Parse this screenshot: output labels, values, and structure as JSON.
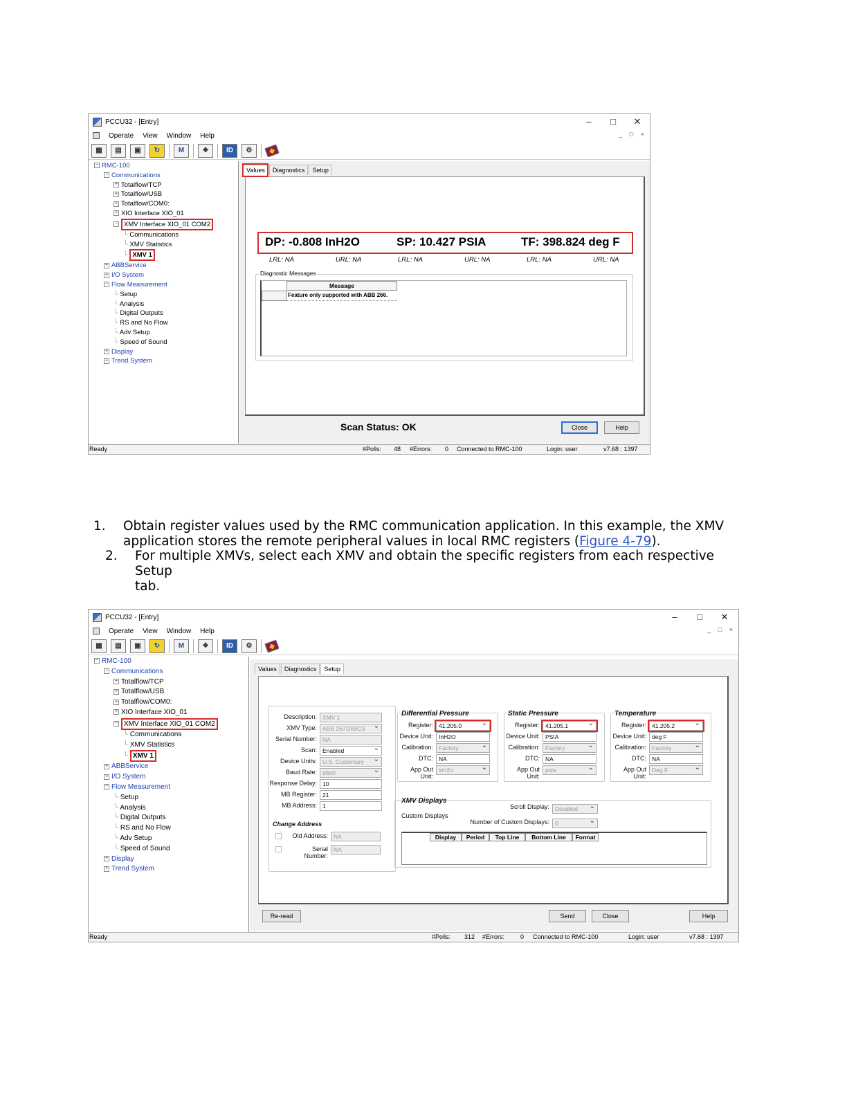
{
  "screen1": {
    "title": "PCCU32 - [Entry]",
    "menu": [
      "Operate",
      "View",
      "Window",
      "Help"
    ],
    "toolbar_icons": [
      "entry-icon",
      "collect-icon",
      "connect-icon",
      "refresh-icon",
      "station-icon",
      "network-icon",
      "calibrate-icon",
      "setup-icon",
      "help-book-icon"
    ],
    "tree": [
      {
        "label": "RMC-100",
        "level": 0,
        "toggle": "minus",
        "blue": true
      },
      {
        "label": "Communications",
        "level": 1,
        "toggle": "minus",
        "blue": true
      },
      {
        "label": "Totalflow/TCP",
        "level": 2,
        "toggle": "plus"
      },
      {
        "label": "Totalflow/USB",
        "level": 2,
        "toggle": "plus"
      },
      {
        "label": "Totalflow/COM0:",
        "level": 2,
        "toggle": "plus"
      },
      {
        "label": "XIO Interface XIO_01",
        "level": 2,
        "toggle": "plus"
      },
      {
        "label": "XMV Interface XIO_01 COM2",
        "level": 2,
        "toggle": "minus",
        "boxed": true
      },
      {
        "label": "Communications",
        "level": 3
      },
      {
        "label": "XMV Statistics",
        "level": 3
      },
      {
        "label": "XMV 1",
        "level": 3,
        "boxed": true,
        "bold": true
      },
      {
        "label": "ABBService",
        "level": 1,
        "toggle": "plus",
        "blue": true
      },
      {
        "label": "I/O System",
        "level": 1,
        "toggle": "plus",
        "blue": true
      },
      {
        "label": "Flow Measurement",
        "level": 1,
        "toggle": "minus",
        "blue": true
      },
      {
        "label": "Setup",
        "level": 2
      },
      {
        "label": "Analysis",
        "level": 2
      },
      {
        "label": "Digital Outputs",
        "level": 2
      },
      {
        "label": "RS and No Flow",
        "level": 2
      },
      {
        "label": "Adv Setup",
        "level": 2
      },
      {
        "label": "Speed of Sound",
        "level": 2
      },
      {
        "label": "Display",
        "level": 1,
        "toggle": "plus",
        "blue": true
      },
      {
        "label": "Trend System",
        "level": 1,
        "toggle": "plus",
        "blue": true
      }
    ],
    "tabs": [
      "Values",
      "Diagnostics",
      "Setup"
    ],
    "readings": {
      "dp": "DP: -0.808 InH2O",
      "sp": "SP: 10.427 PSIA",
      "tf": "TF: 398.824 deg F"
    },
    "limits": [
      "LRL: NA",
      "URL: NA",
      "LRL: NA",
      "URL: NA",
      "LRL: NA",
      "URL: NA"
    ],
    "diag_group": "Diagnostic Messages",
    "diag_col": "Message",
    "diag_msg": "Feature only supported with ABB 266.",
    "scan_status": "Scan Status: OK",
    "close_label": "Close",
    "help_label": "Help",
    "status": {
      "ready": "Ready",
      "polls_label": "#Polls:",
      "polls": "48",
      "errors_label": "#Errors:",
      "errors": "0",
      "connected": "Connected to RMC-100",
      "login": "Login: user",
      "version": "v7.68 : 1397"
    }
  },
  "instructions": {
    "step1_num": "1.",
    "step1_a": "Obtain register values used by the RMC communication application. In this example, the XMV",
    "step1_b": "application stores the remote peripheral values in local RMC registers (",
    "step1_link": "Figure 4-79",
    "step1_c": ").",
    "step2_num": "2.",
    "step2_a": "For multiple XMVs, select each XMV and obtain the specific registers from each respective Setup",
    "step2_b": "tab."
  },
  "screen2": {
    "title": "PCCU32 - [Entry]",
    "menu": [
      "Operate",
      "View",
      "Window",
      "Help"
    ],
    "tabs": [
      "Values",
      "Diagnostics",
      "Setup"
    ],
    "general": [
      {
        "label": "Description:",
        "value": "XMV 1",
        "disabled": true
      },
      {
        "label": "XMV Type:",
        "value": "ABB 267/269CS",
        "disabled": true,
        "dropdown": true
      },
      {
        "label": "Serial Number:",
        "value": "NA",
        "disabled": true
      },
      {
        "label": "Scan:",
        "value": "Enabled",
        "dropdown": true
      },
      {
        "label": "Device Units:",
        "value": "U.S. Customary",
        "disabled": true,
        "dropdown": true
      },
      {
        "label": "Baud Rate:",
        "value": "9600",
        "disabled": true,
        "dropdown": true
      },
      {
        "label": "Response Delay:",
        "value": "10"
      },
      {
        "label": "MB Register:",
        "value": "21"
      },
      {
        "label": "MB Address:",
        "value": "1"
      }
    ],
    "change_address": {
      "title": "Change Address",
      "old_label": "Old Address:",
      "old_value": "NA",
      "serial_label": "Serial Number:",
      "serial_value": "NA"
    },
    "groups": [
      {
        "title": "Differential Pressure",
        "rows": [
          {
            "label": "Register:",
            "value": "41.205.0",
            "dropdown": true,
            "boxed": true
          },
          {
            "label": "Device Unit:",
            "value": "InH2O"
          },
          {
            "label": "Calibration:",
            "value": "Factory",
            "disabled": true,
            "dropdown": true
          },
          {
            "label": "DTC:",
            "value": "NA"
          },
          {
            "label": "App Out Unit:",
            "value": "inh2o",
            "disabled": true,
            "dropdown": true
          }
        ]
      },
      {
        "title": "Static Pressure",
        "rows": [
          {
            "label": "Register:",
            "value": "41.205.1",
            "dropdown": true,
            "boxed": true
          },
          {
            "label": "Device Unit:",
            "value": "PSIA"
          },
          {
            "label": "Calibration:",
            "value": "Factory",
            "disabled": true,
            "dropdown": true
          },
          {
            "label": "DTC:",
            "value": "NA"
          },
          {
            "label": "App Out Unit:",
            "value": "psia",
            "disabled": true,
            "dropdown": true
          }
        ]
      },
      {
        "title": "Temperature",
        "rows": [
          {
            "label": "Register:",
            "value": "41.205.2",
            "dropdown": true,
            "boxed": true
          },
          {
            "label": "Device Unit:",
            "value": "deg F"
          },
          {
            "label": "Calibration:",
            "value": "Factory",
            "disabled": true,
            "dropdown": true
          },
          {
            "label": "DTC:",
            "value": "NA"
          },
          {
            "label": "App Out Unit:",
            "value": "Deg F",
            "disabled": true,
            "dropdown": true
          }
        ]
      }
    ],
    "displays": {
      "title": "XMV Displays",
      "scroll_label": "Scroll Display:",
      "scroll_value": "Disabled",
      "custom_label": "Custom Displays",
      "num_label": "Number of Custom Displays:",
      "num_value": "0",
      "columns": [
        "Display",
        "Period",
        "Top Line",
        "Bottom Line",
        "Format"
      ]
    },
    "buttons": {
      "reread": "Re-read",
      "send": "Send",
      "close": "Close",
      "help": "Help"
    },
    "status": {
      "ready": "Ready",
      "polls_label": "#Polls:",
      "polls": "312",
      "errors_label": "#Errors:",
      "errors": "0",
      "connected": "Connected to RMC-100",
      "login": "Login: user",
      "version": "v7.68 : 1397"
    }
  },
  "colors": {
    "highlight": "#d62b2b",
    "tree_link": "#1f3fb0",
    "link": "#2a56c6"
  }
}
